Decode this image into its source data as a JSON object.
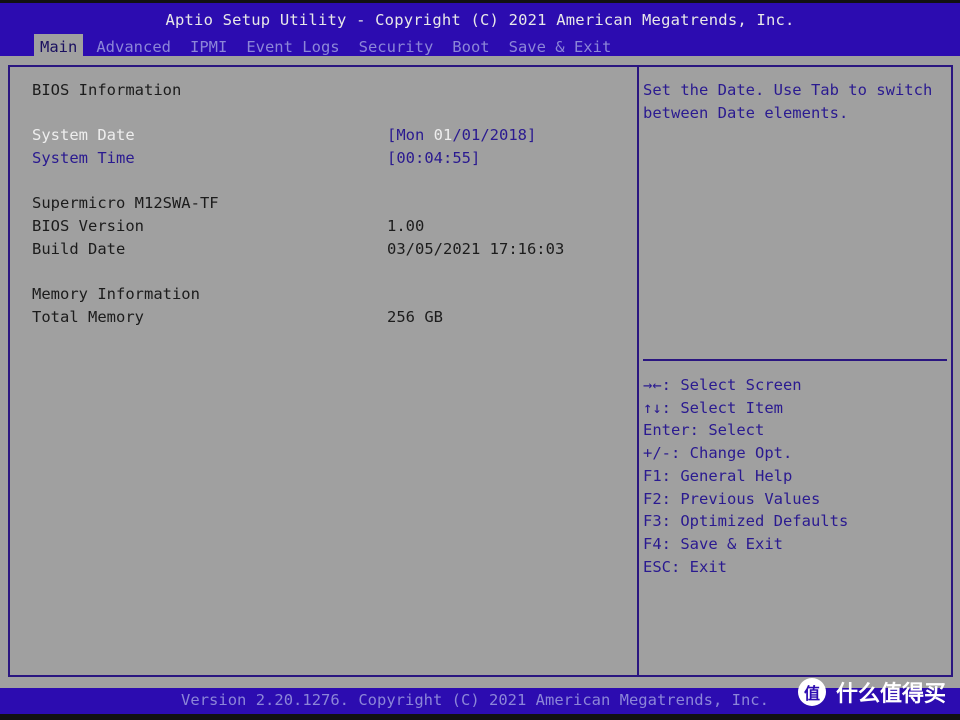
{
  "header": {
    "title": "Aptio Setup Utility - Copyright (C) 2021 American Megatrends, Inc.",
    "tabs": [
      {
        "label": "Main",
        "active": true
      },
      {
        "label": "Advanced",
        "active": false
      },
      {
        "label": "IPMI",
        "active": false
      },
      {
        "label": "Event Logs",
        "active": false
      },
      {
        "label": "Security",
        "active": false
      },
      {
        "label": "Boot",
        "active": false
      },
      {
        "label": "Save & Exit",
        "active": false
      }
    ]
  },
  "main": {
    "bios_info_heading": "BIOS Information",
    "system_date": {
      "label": "System Date",
      "prefix": "[Mon ",
      "highlight": "01",
      "suffix": "/01/2018]"
    },
    "system_time": {
      "label": "System Time",
      "value": "[00:04:55]"
    },
    "board_name": "Supermicro M12SWA-TF",
    "bios_version": {
      "label": "BIOS Version",
      "value": "1.00"
    },
    "build_date": {
      "label": "Build Date",
      "value": "03/05/2021 17:16:03"
    },
    "memory_heading": "Memory Information",
    "total_memory": {
      "label": "Total Memory",
      "value": "256 GB"
    }
  },
  "help": {
    "text": "Set the Date. Use Tab to switch between Date elements.",
    "keys": [
      "→←: Select Screen",
      "↑↓: Select Item",
      "Enter: Select",
      "+/-: Change Opt.",
      "F1: General Help",
      "F2: Previous Values",
      "F3: Optimized Defaults",
      "F4: Save & Exit",
      "ESC: Exit"
    ]
  },
  "footer": {
    "text": "Version 2.20.1276. Copyright (C) 2021 American Megatrends, Inc.",
    "watermark_glyph": "值",
    "watermark_text": "什么值得买"
  }
}
